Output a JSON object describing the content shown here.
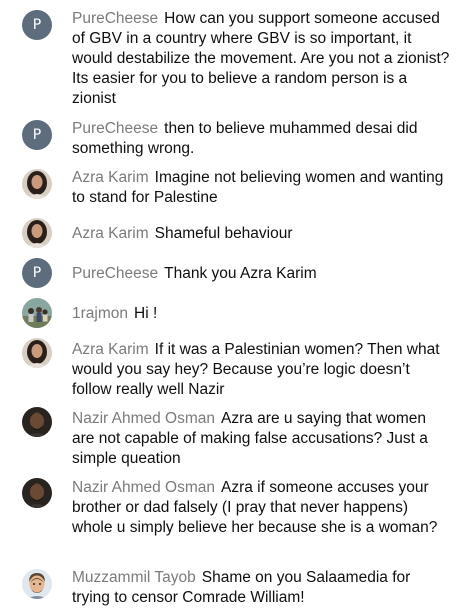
{
  "chat": {
    "messages": [
      {
        "author": "PureCheese",
        "avatar_letter": "P",
        "avatar_type": "letter",
        "text": "How can you support someone accused of GBV in a country where GBV is so important, it would destabilize the movement. Are you not a zionist? Its easier for you to believe a random person is a zionist"
      },
      {
        "author": "PureCheese",
        "avatar_letter": "P",
        "avatar_type": "letter",
        "text": "then to believe muhammed desai did something wrong."
      },
      {
        "author": "Azra Karim",
        "avatar_type": "photo-woman",
        "text": "Imagine not believing women and wanting to stand for Palestine"
      },
      {
        "author": "Azra Karim",
        "avatar_type": "photo-woman",
        "text": "Shameful behaviour"
      },
      {
        "author": "PureCheese",
        "avatar_letter": "P",
        "avatar_type": "letter",
        "text": "Thank you Azra Karim"
      },
      {
        "author": "1rajmon",
        "avatar_type": "photo-group",
        "text": "Hi !"
      },
      {
        "author": "Azra Karim",
        "avatar_type": "photo-woman",
        "text": "If it was a Palestinian women? Then what would you say hey? Because you’re logic doesn’t follow really well Nazir"
      },
      {
        "author": "Nazir Ahmed Osman",
        "avatar_type": "photo-dark",
        "text": "Azra are u saying that women are not capable of making false accusations? Just a simple queation"
      },
      {
        "author": "Nazir Ahmed Osman",
        "avatar_type": "photo-dark",
        "text": "Azra if someone accuses your brother or dad falsely (I pray that never happens) whole u simply believe her because she is a woman?"
      },
      {
        "author": "Muzzammil Tayob",
        "avatar_type": "cartoon-man",
        "text": "Shame on you Salaamedia for trying to censor Comrade William!"
      }
    ]
  },
  "colors": {
    "author_text": "#7b7b7b",
    "message_text": "#0f0f0f",
    "letter_avatar_bg": "#5d6d7e",
    "background": "#ffffff"
  }
}
